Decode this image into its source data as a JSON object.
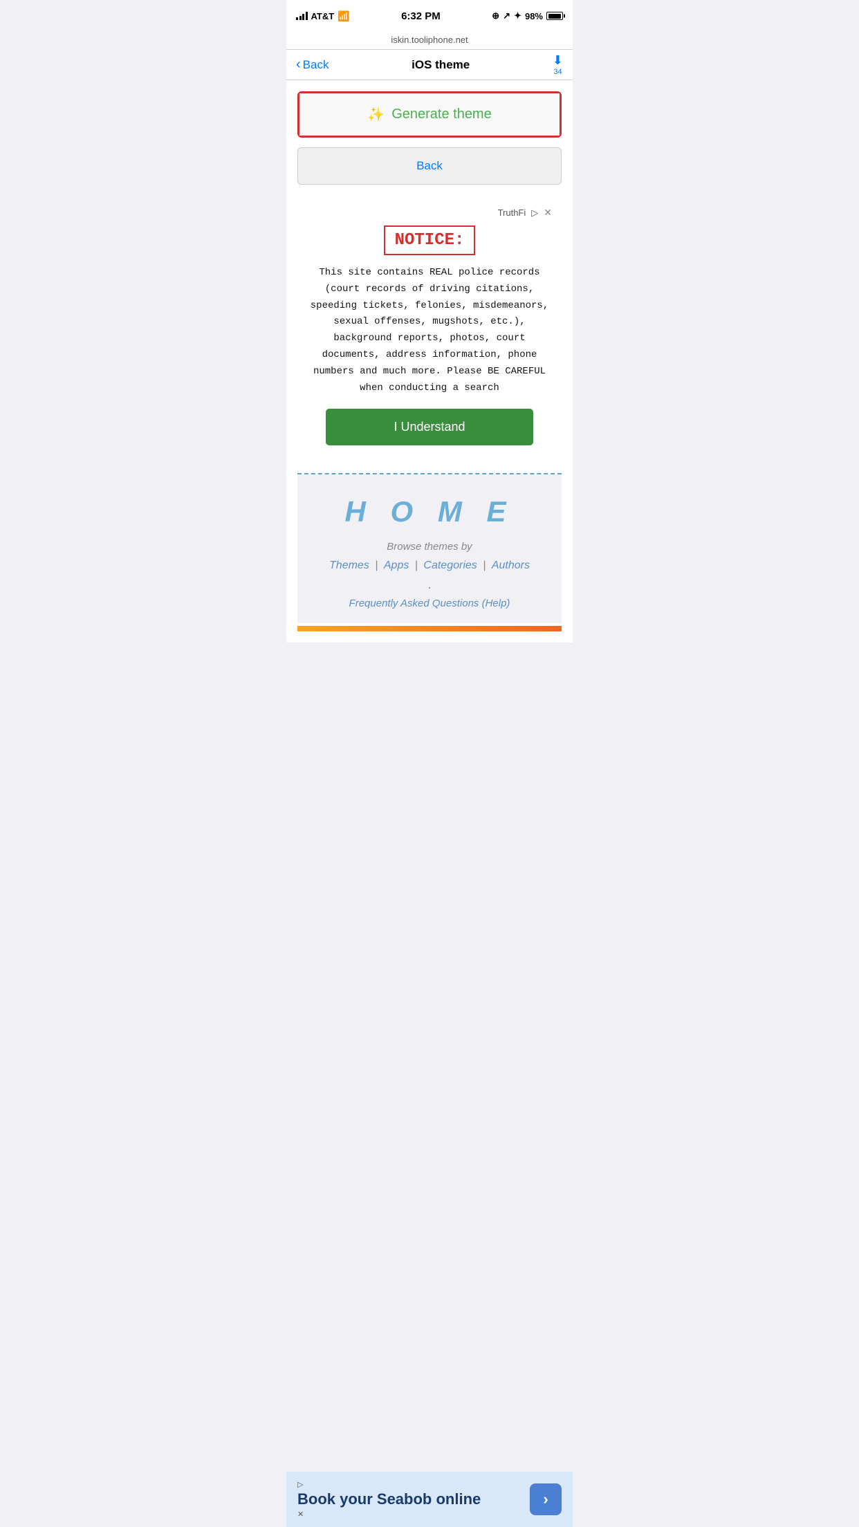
{
  "status_bar": {
    "carrier": "AT&T",
    "time": "6:32 PM",
    "battery": "98%",
    "url": "iskin.tooliphone.net"
  },
  "nav": {
    "back_label": "Back",
    "title": "iOS theme",
    "action_label": "34"
  },
  "main": {
    "generate_icon": "✨",
    "generate_label": "Generate theme",
    "back_button_label": "Back"
  },
  "ad": {
    "source": "TruthFi",
    "notice_label": "NOTICE:",
    "notice_text": "This site contains REAL police records (court records of driving citations, speeding tickets, felonies, misdemeanors, sexual offenses, mugshots, etc.), background reports, photos, court documents, address information, phone numbers and much more. Please BE CAREFUL when conducting a search",
    "understand_label": "I Understand"
  },
  "home": {
    "title": "H O M E",
    "browse_label": "Browse themes by",
    "links": {
      "themes": "Themes",
      "apps": "Apps",
      "categories": "Categories",
      "authors": "Authors"
    },
    "faq_label": "Frequently Asked Questions (Help)"
  },
  "bottom_banner": {
    "ad_icon": "▷",
    "text": "Book your Seabob online",
    "close_label": "✕",
    "arrow": "›"
  }
}
